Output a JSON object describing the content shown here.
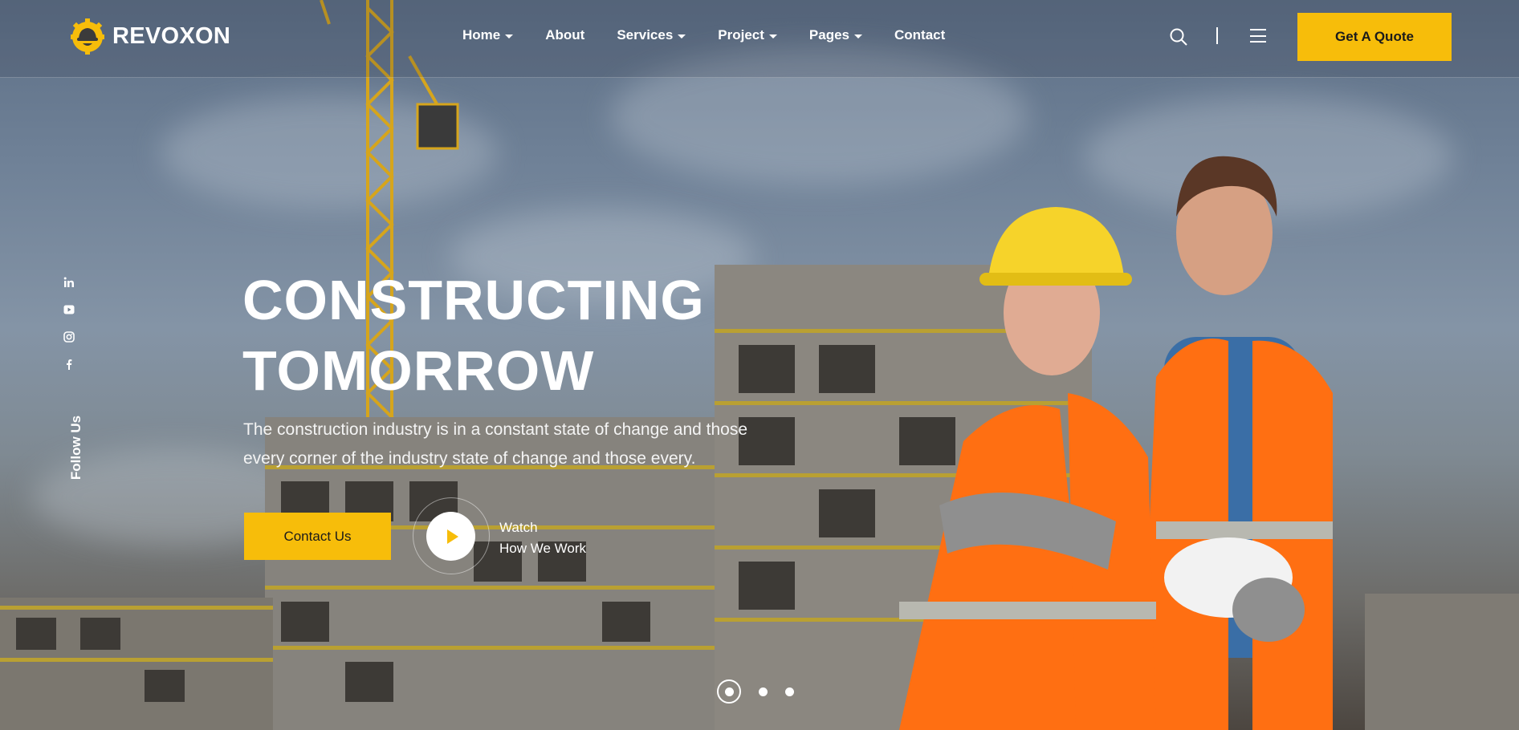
{
  "brand": {
    "name": "REVOXON",
    "accent": "#f7bd0a"
  },
  "nav": {
    "items": [
      {
        "label": "Home",
        "dropdown": true
      },
      {
        "label": "About",
        "dropdown": false
      },
      {
        "label": "Services",
        "dropdown": true
      },
      {
        "label": "Project",
        "dropdown": true
      },
      {
        "label": "Pages",
        "dropdown": true
      },
      {
        "label": "Contact",
        "dropdown": false
      }
    ],
    "quote_label": "Get A Quote"
  },
  "social": {
    "icons": [
      "linkedin-icon",
      "youtube-icon",
      "instagram-icon",
      "facebook-icon"
    ],
    "follow_label": "Follow Us"
  },
  "hero": {
    "title_line1": "CONSTRUCTING",
    "title_line2": "TOMORROW",
    "desc_line1": "The construction industry is in a constant state of change and those",
    "desc_line2": "every corner of the industry state of change and those every.",
    "contact_label": "Contact Us",
    "watch_line1": "Watch",
    "watch_line2": "How We Work"
  },
  "slider": {
    "count": 3,
    "active": 1
  }
}
